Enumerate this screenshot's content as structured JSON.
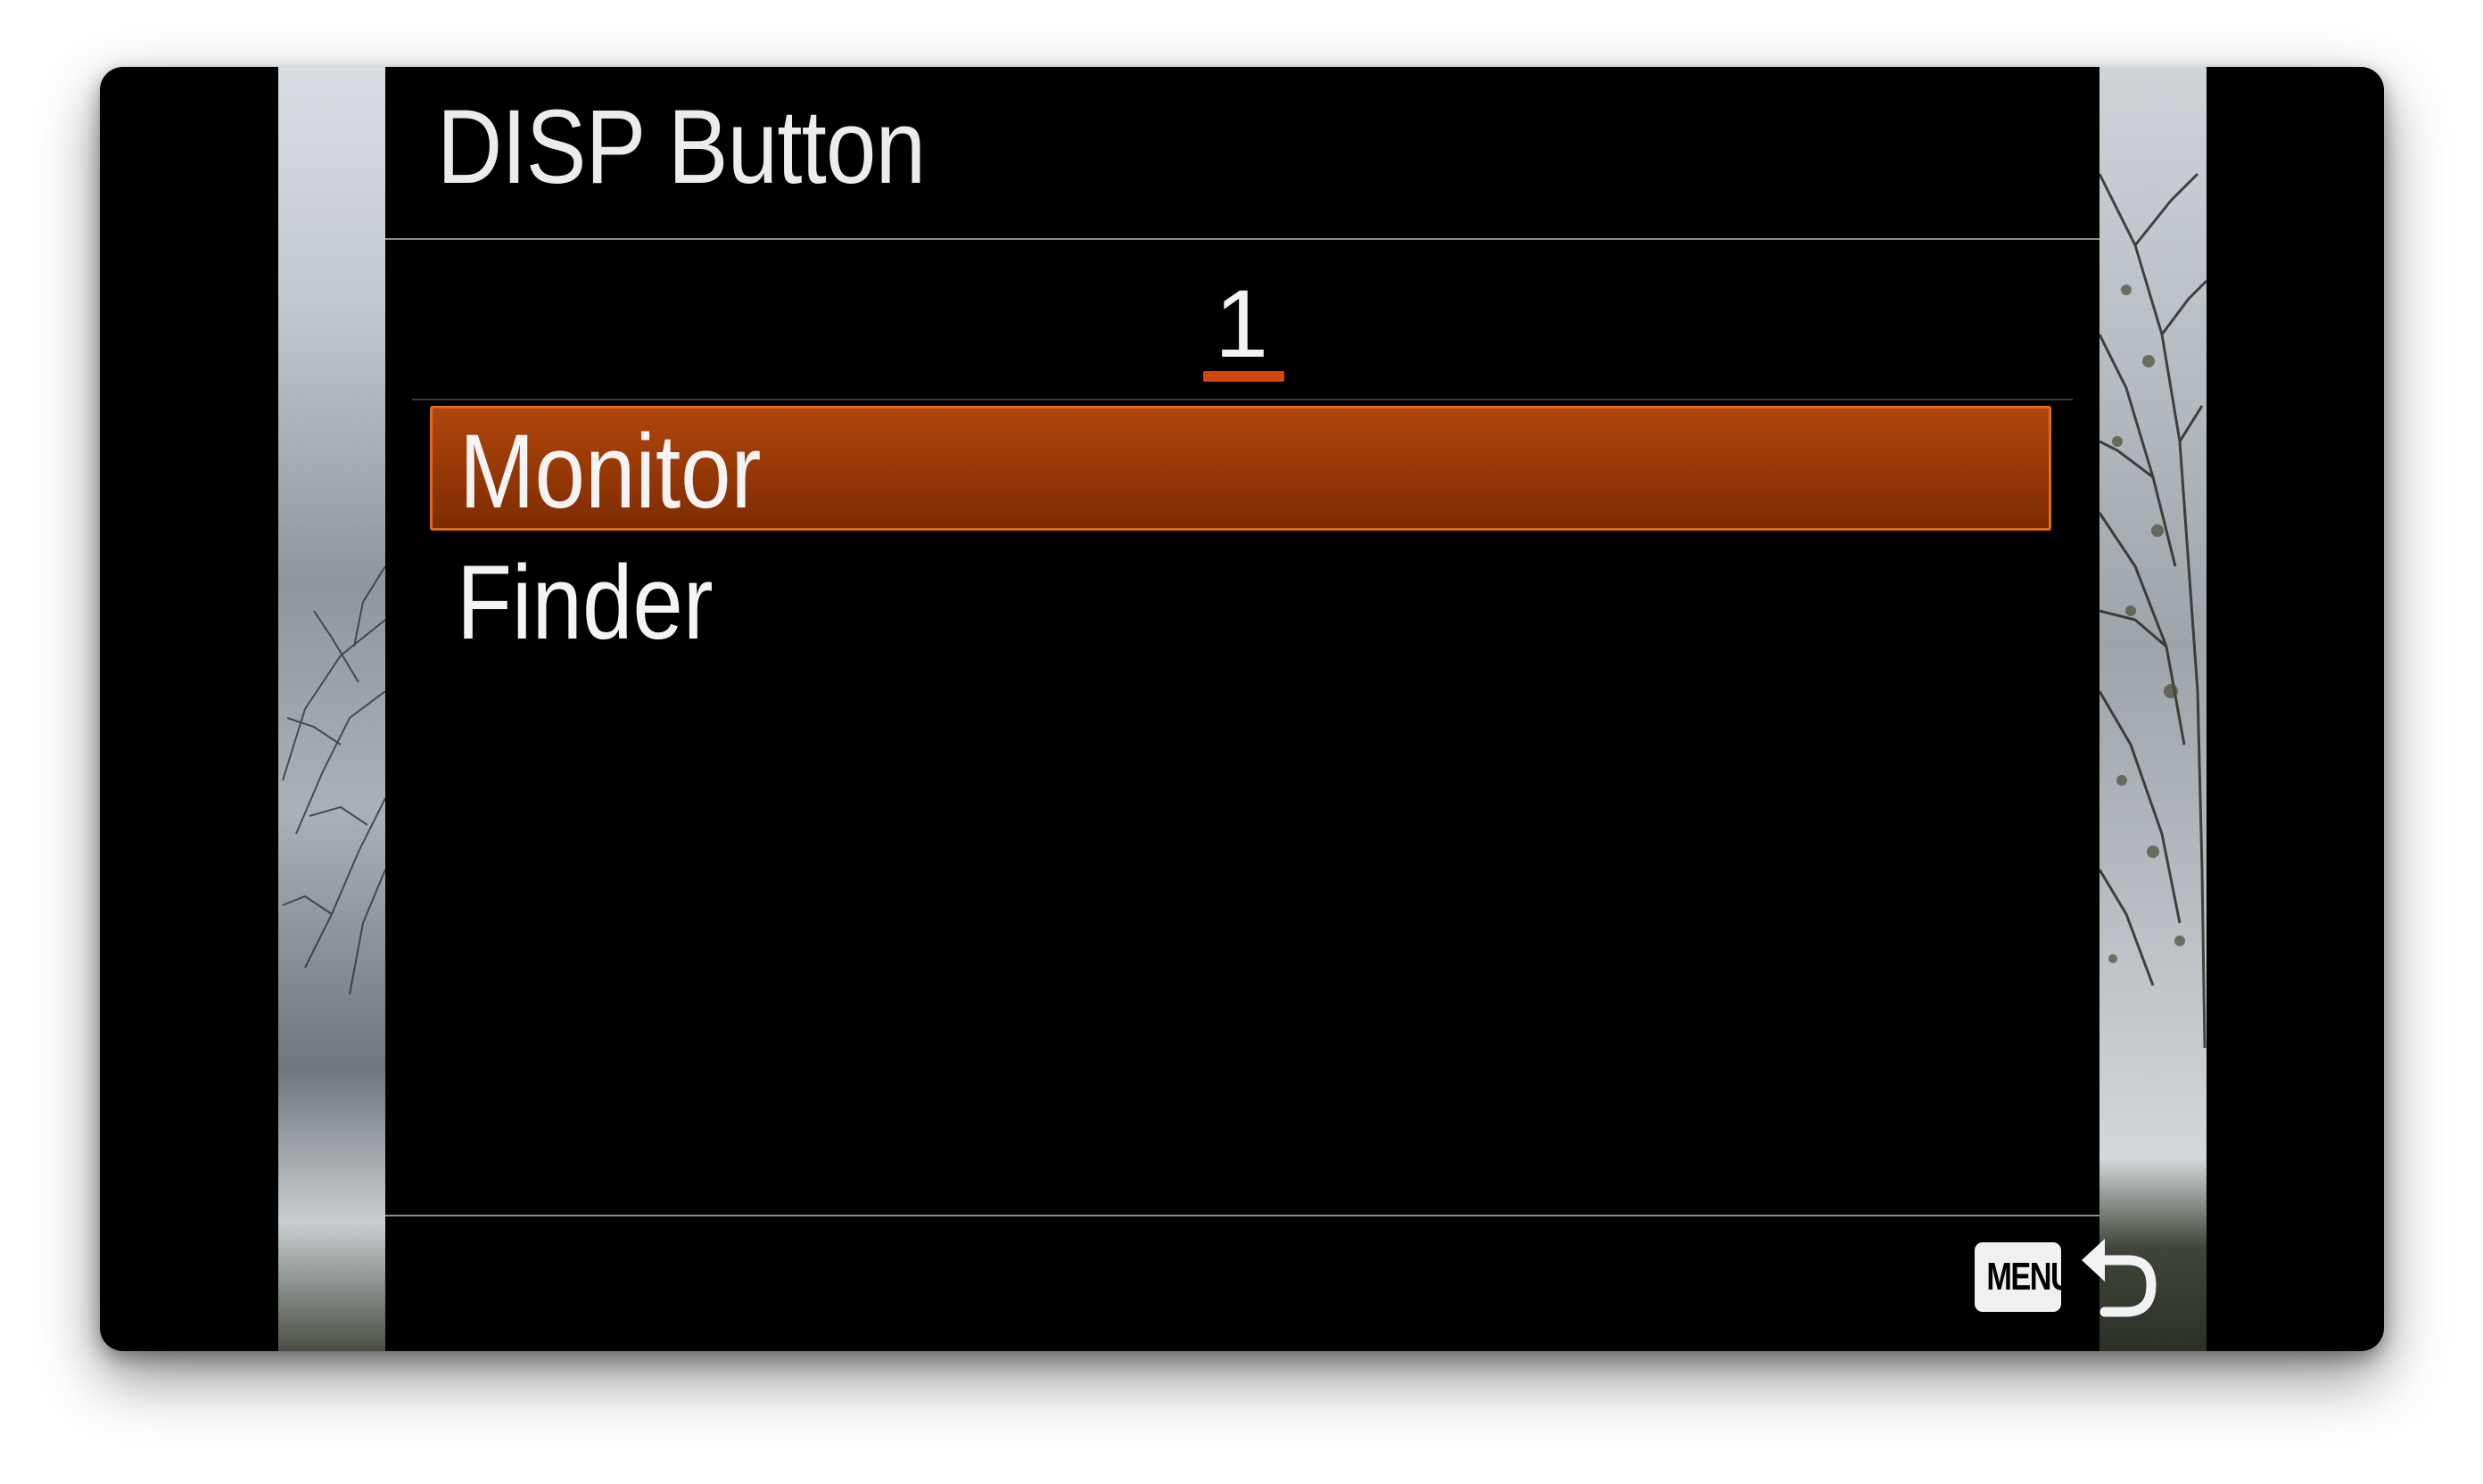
{
  "header": {
    "title": "DISP Button"
  },
  "tabs": {
    "current": "1"
  },
  "menu": {
    "items": [
      {
        "label": "Monitor",
        "selected": true
      },
      {
        "label": "Finder",
        "selected": false
      }
    ]
  },
  "footer": {
    "menu_badge": "MENU",
    "back_icon": "return-arrow-icon"
  },
  "colors": {
    "accent": "#d2450d",
    "selection": "#9a3a07",
    "text": "#f4f4f4",
    "background": "#000000"
  }
}
